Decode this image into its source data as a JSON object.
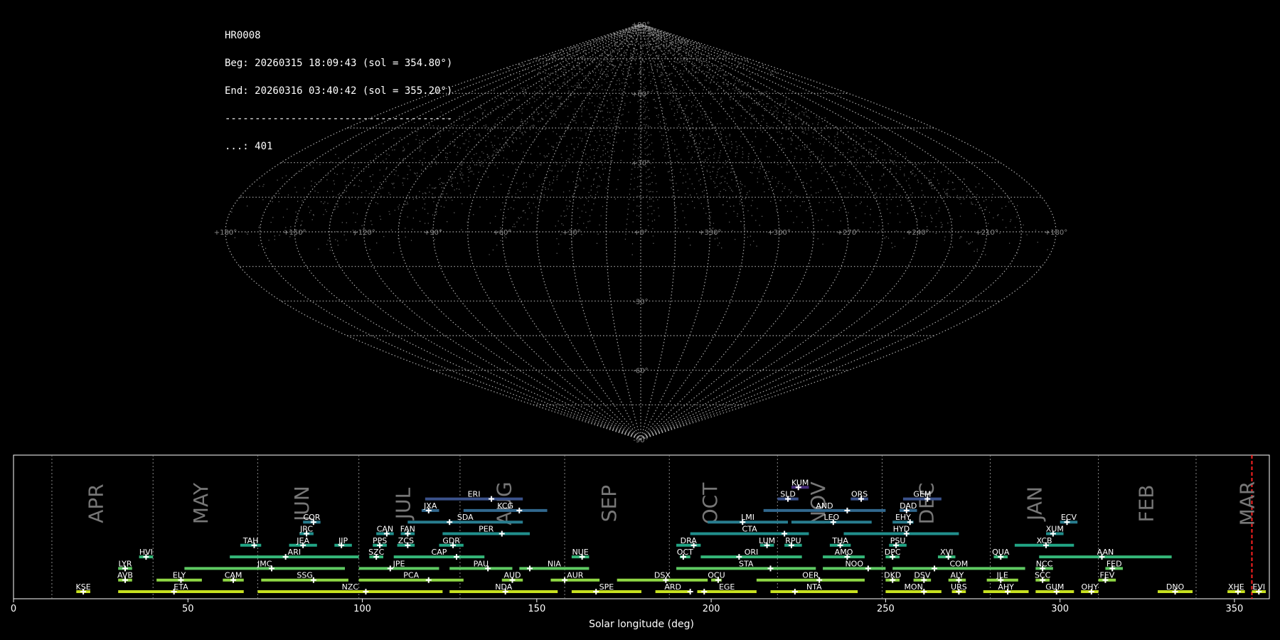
{
  "info": {
    "station": "HR0008",
    "begin": "Beg: 20260315 18:09:43 (sol = 354.80°)",
    "end": "End: 20260316 03:40:42 (sol = 355.20°)",
    "separator": "--------------------------------------",
    "count": "...: 401"
  },
  "sky_map": {
    "projection": "sinusoidal",
    "longitude_labels": [
      "+180°",
      "+150°",
      "+120°",
      "+90°",
      "+60°",
      "+30°",
      "+0°",
      "+330°",
      "+300°",
      "+270°",
      "+240°",
      "+210°",
      "+180°"
    ],
    "latitude_labels": [
      "+90°",
      "+60°",
      "+30°",
      "-30°",
      "-60°",
      "-90°"
    ],
    "point_color": "#808080",
    "grid_color": "#aaaaaa"
  },
  "chart_data": {
    "type": "bar",
    "xlabel": "Solar longitude (deg)",
    "xlim": [
      0,
      360
    ],
    "xticks": [
      0,
      50,
      100,
      150,
      200,
      250,
      300,
      350
    ],
    "months": [
      {
        "label": "APR",
        "pos": 24
      },
      {
        "label": "MAY",
        "pos": 54
      },
      {
        "label": "JUN",
        "pos": 83
      },
      {
        "label": "JUL",
        "pos": 112
      },
      {
        "label": "AUG",
        "pos": 141
      },
      {
        "label": "SEP",
        "pos": 171
      },
      {
        "label": "OCT",
        "pos": 200
      },
      {
        "label": "NOV",
        "pos": 231
      },
      {
        "label": "DEC",
        "pos": 262
      },
      {
        "label": "JAN",
        "pos": 293
      },
      {
        "label": "FEB",
        "pos": 325
      },
      {
        "label": "MAR",
        "pos": 354
      }
    ],
    "month_boundaries": [
      11,
      40,
      70,
      99,
      128,
      158,
      188,
      219,
      249,
      280,
      311,
      339
    ],
    "current_solar_longitude": 355.0,
    "showers": [
      {
        "code": "KSE",
        "start": 18,
        "end": 22,
        "peak": 20,
        "row": 0
      },
      {
        "code": "ETA",
        "start": 30,
        "end": 66,
        "peak": 46,
        "row": 0
      },
      {
        "code": "NZC",
        "start": 70,
        "end": 123,
        "peak": 101,
        "row": 0
      },
      {
        "code": "NDA",
        "start": 125,
        "end": 156,
        "peak": 141,
        "row": 0
      },
      {
        "code": "SPE",
        "start": 160,
        "end": 180,
        "peak": 167,
        "row": 0
      },
      {
        "code": "ARD",
        "start": 184,
        "end": 194,
        "peak": 194,
        "row": 0
      },
      {
        "code": "EGE",
        "start": 196,
        "end": 213,
        "peak": 198,
        "row": 0
      },
      {
        "code": "NTA",
        "start": 217,
        "end": 242,
        "peak": 224,
        "row": 0
      },
      {
        "code": "MON",
        "start": 250,
        "end": 266,
        "peak": 261,
        "row": 0
      },
      {
        "code": "URS",
        "start": 269,
        "end": 273,
        "peak": 271,
        "row": 0
      },
      {
        "code": "AHY",
        "start": 278,
        "end": 291,
        "peak": 285,
        "row": 0
      },
      {
        "code": "GUM",
        "start": 293,
        "end": 304,
        "peak": 299,
        "row": 0
      },
      {
        "code": "OHY",
        "start": 306,
        "end": 311,
        "peak": 309,
        "row": 0
      },
      {
        "code": "DNO",
        "start": 328,
        "end": 338,
        "peak": 333,
        "row": 0
      },
      {
        "code": "XHE",
        "start": 348,
        "end": 353,
        "peak": 351,
        "row": 0
      },
      {
        "code": "EVI",
        "start": 355,
        "end": 359,
        "peak": 357,
        "row": 0
      },
      {
        "code": "AVB",
        "start": 30,
        "end": 34,
        "peak": 32,
        "row": 1
      },
      {
        "code": "ELY",
        "start": 41,
        "end": 54,
        "peak": 48,
        "row": 1
      },
      {
        "code": "CAM",
        "start": 60,
        "end": 66,
        "peak": 63,
        "row": 1
      },
      {
        "code": "SSG",
        "start": 71,
        "end": 96,
        "peak": 86,
        "row": 1
      },
      {
        "code": "PCA",
        "start": 99,
        "end": 129,
        "peak": 119,
        "row": 1
      },
      {
        "code": "AUD",
        "start": 140,
        "end": 146,
        "peak": 143,
        "row": 1
      },
      {
        "code": "AUR",
        "start": 154,
        "end": 168,
        "peak": 158,
        "row": 1
      },
      {
        "code": "DSX",
        "start": 173,
        "end": 199,
        "peak": 187,
        "row": 1
      },
      {
        "code": "OCU",
        "start": 200,
        "end": 203,
        "peak": 202,
        "row": 1
      },
      {
        "code": "OER",
        "start": 213,
        "end": 244,
        "peak": 231,
        "row": 1
      },
      {
        "code": "DKD",
        "start": 250,
        "end": 254,
        "peak": 252,
        "row": 1
      },
      {
        "code": "DSV",
        "start": 258,
        "end": 263,
        "peak": 261,
        "row": 1
      },
      {
        "code": "ALY",
        "start": 268,
        "end": 273,
        "peak": 271,
        "row": 1
      },
      {
        "code": "JLE",
        "start": 279,
        "end": 288,
        "peak": 283,
        "row": 1
      },
      {
        "code": "SCC",
        "start": 293,
        "end": 297,
        "peak": 295,
        "row": 1
      },
      {
        "code": "FEV",
        "start": 311,
        "end": 316,
        "peak": 313,
        "row": 1
      },
      {
        "code": "LYR",
        "start": 30,
        "end": 34,
        "peak": 32,
        "row": 2
      },
      {
        "code": "JMC",
        "start": 49,
        "end": 95,
        "peak": 74,
        "row": 2
      },
      {
        "code": "JPE",
        "start": 99,
        "end": 122,
        "peak": 108,
        "row": 2
      },
      {
        "code": "PAU",
        "start": 125,
        "end": 143,
        "peak": 136,
        "row": 2
      },
      {
        "code": "NIA",
        "start": 145,
        "end": 165,
        "peak": 148,
        "row": 2
      },
      {
        "code": "STA",
        "start": 190,
        "end": 230,
        "peak": 217,
        "row": 2
      },
      {
        "code": "NOO",
        "start": 232,
        "end": 250,
        "peak": 245,
        "row": 2
      },
      {
        "code": "COM",
        "start": 252,
        "end": 290,
        "peak": 264,
        "row": 2
      },
      {
        "code": "NCC",
        "start": 293,
        "end": 298,
        "peak": 295,
        "row": 2
      },
      {
        "code": "FED",
        "start": 313,
        "end": 318,
        "peak": 315,
        "row": 2
      },
      {
        "code": "HVI",
        "start": 36,
        "end": 40,
        "peak": 38,
        "row": 3
      },
      {
        "code": "ARI",
        "start": 62,
        "end": 99,
        "peak": 78,
        "row": 3
      },
      {
        "code": "SZC",
        "start": 102,
        "end": 106,
        "peak": 104,
        "row": 3
      },
      {
        "code": "CAP",
        "start": 109,
        "end": 135,
        "peak": 127,
        "row": 3
      },
      {
        "code": "NUE",
        "start": 160,
        "end": 165,
        "peak": 163,
        "row": 3
      },
      {
        "code": "OCT",
        "start": 191,
        "end": 194,
        "peak": 192,
        "row": 3
      },
      {
        "code": "ORI",
        "start": 197,
        "end": 226,
        "peak": 208,
        "row": 3
      },
      {
        "code": "AMO",
        "start": 232,
        "end": 244,
        "peak": 239,
        "row": 3
      },
      {
        "code": "DPC",
        "start": 250,
        "end": 254,
        "peak": 252,
        "row": 3
      },
      {
        "code": "XVI",
        "start": 265,
        "end": 270,
        "peak": 268,
        "row": 3
      },
      {
        "code": "QUA",
        "start": 281,
        "end": 285,
        "peak": 283,
        "row": 3
      },
      {
        "code": "AAN",
        "start": 294,
        "end": 332,
        "peak": 312,
        "row": 3
      },
      {
        "code": "TAH",
        "start": 65,
        "end": 71,
        "peak": 69,
        "row": 4
      },
      {
        "code": "JEA",
        "start": 79,
        "end": 87,
        "peak": 83,
        "row": 4
      },
      {
        "code": "JIP",
        "start": 92,
        "end": 97,
        "peak": 94,
        "row": 4
      },
      {
        "code": "PPS",
        "start": 103,
        "end": 107,
        "peak": 105,
        "row": 4
      },
      {
        "code": "ZCS",
        "start": 110,
        "end": 115,
        "peak": 113,
        "row": 4
      },
      {
        "code": "GDR",
        "start": 122,
        "end": 129,
        "peak": 126,
        "row": 4
      },
      {
        "code": "DRA",
        "start": 190,
        "end": 197,
        "peak": 195,
        "row": 4
      },
      {
        "code": "LUM",
        "start": 214,
        "end": 218,
        "peak": 216,
        "row": 4
      },
      {
        "code": "RPU",
        "start": 221,
        "end": 226,
        "peak": 223,
        "row": 4
      },
      {
        "code": "THA",
        "start": 234,
        "end": 240,
        "peak": 237,
        "row": 4
      },
      {
        "code": "PSU",
        "start": 251,
        "end": 256,
        "peak": 253,
        "row": 4
      },
      {
        "code": "XCB",
        "start": 287,
        "end": 304,
        "peak": 296,
        "row": 4
      },
      {
        "code": "JRC",
        "start": 82,
        "end": 86,
        "peak": 84,
        "row": 5
      },
      {
        "code": "CAN",
        "start": 104,
        "end": 109,
        "peak": 107,
        "row": 5
      },
      {
        "code": "FAN",
        "start": 111,
        "end": 115,
        "peak": 113,
        "row": 5
      },
      {
        "code": "PER",
        "start": 123,
        "end": 148,
        "peak": 140,
        "row": 5
      },
      {
        "code": "CTA",
        "start": 194,
        "end": 228,
        "peak": 221,
        "row": 5
      },
      {
        "code": "HYD",
        "start": 238,
        "end": 271,
        "peak": 256,
        "row": 5
      },
      {
        "code": "XUM",
        "start": 296,
        "end": 301,
        "peak": 298,
        "row": 5
      },
      {
        "code": "COR",
        "start": 83,
        "end": 88,
        "peak": 86,
        "row": 6
      },
      {
        "code": "SDA",
        "start": 113,
        "end": 146,
        "peak": 125,
        "row": 6
      },
      {
        "code": "LMI",
        "start": 199,
        "end": 222,
        "peak": 209,
        "row": 6
      },
      {
        "code": "LEO",
        "start": 223,
        "end": 246,
        "peak": 235,
        "row": 6
      },
      {
        "code": "EHY",
        "start": 252,
        "end": 258,
        "peak": 257,
        "row": 6
      },
      {
        "code": "ECV",
        "start": 300,
        "end": 305,
        "peak": 302,
        "row": 6
      },
      {
        "code": "JXA",
        "start": 117,
        "end": 122,
        "peak": 119,
        "row": 7
      },
      {
        "code": "KCG",
        "start": 129,
        "end": 153,
        "peak": 145,
        "row": 7
      },
      {
        "code": "AND",
        "start": 215,
        "end": 250,
        "peak": 239,
        "row": 7
      },
      {
        "code": "DAD",
        "start": 254,
        "end": 259,
        "peak": 256,
        "row": 7
      },
      {
        "code": "ERI",
        "start": 118,
        "end": 146,
        "peak": 137,
        "row": 8
      },
      {
        "code": "SLD",
        "start": 219,
        "end": 225,
        "peak": 222,
        "row": 8
      },
      {
        "code": "ORS",
        "start": 240,
        "end": 245,
        "peak": 243,
        "row": 8
      },
      {
        "code": "GEM",
        "start": 255,
        "end": 266,
        "peak": 262,
        "row": 8
      },
      {
        "code": "KUM",
        "start": 223,
        "end": 228,
        "peak": 225,
        "row": 9
      }
    ]
  }
}
